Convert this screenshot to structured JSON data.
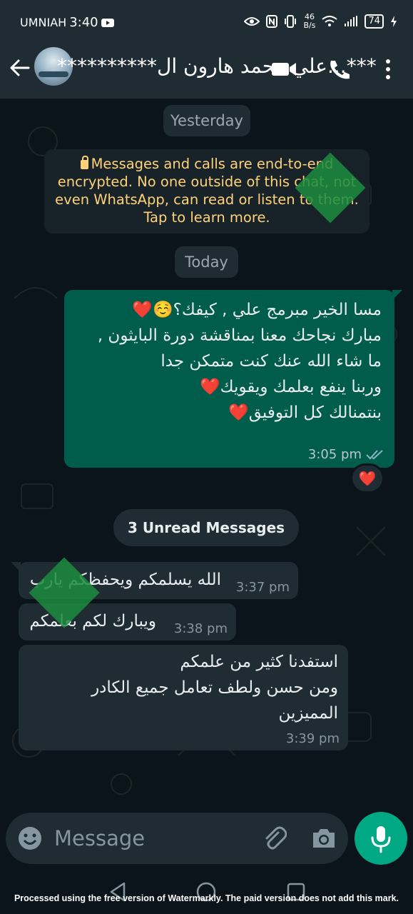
{
  "status_bar": {
    "carrier": "UMNIAH",
    "time": "3:40",
    "net_rate": "46",
    "net_unit": "B/s",
    "battery": "74"
  },
  "header": {
    "contact_name": "**********علي محمد هارون ال...***"
  },
  "chat": {
    "date_yesterday": "Yesterday",
    "encryption_notice": "Messages and calls are end-to-end encrypted. No one outside of this chat, not even WhatsApp, can read or listen to them. Tap to learn more.",
    "date_today": "Today",
    "outgoing": {
      "lines": [
        "مسا الخير مبرمج علي , كيفك؟☺️❤️",
        "مبارك نجاحك معنا بمناقشة  دورة البايثون ,",
        "ما شاء الله عنك كنت متمكن جدا",
        "وربنا ينفع بعلمك ويقويك❤️",
        "بنتمنالك كل التوفيق❤️"
      ],
      "time": "3:05 pm",
      "reaction": "❤️"
    },
    "unread_label": "3 Unread Messages",
    "incoming": [
      {
        "text": "الله يسلمكم ويحفظكم يارب",
        "time": "3:37 pm"
      },
      {
        "text": "ويبارك لكم بعلمكم",
        "time": "3:38 pm"
      },
      {
        "lines": [
          "استفدنا كثير من علمكم",
          "ومن حسن ولطف تعامل جميع الكادر",
          "المميزين"
        ],
        "time": "3:39 pm"
      }
    ]
  },
  "composer": {
    "placeholder": "Message"
  },
  "watermark": "Processed using the free version of Watermarkly. The paid version does not add this mark.",
  "colors": {
    "header_bg": "#1f2c34",
    "chat_bg": "#0b141a",
    "outgoing_bubble": "#005c4b",
    "incoming_bubble": "#1f2c34",
    "accent": "#00a884",
    "notice_text": "#ffd279"
  },
  "icons": [
    "back-arrow-icon",
    "video-call-icon",
    "phone-icon",
    "more-vert-icon",
    "lock-icon",
    "double-check-icon",
    "emoji-icon",
    "attach-icon",
    "camera-icon",
    "mic-icon"
  ]
}
